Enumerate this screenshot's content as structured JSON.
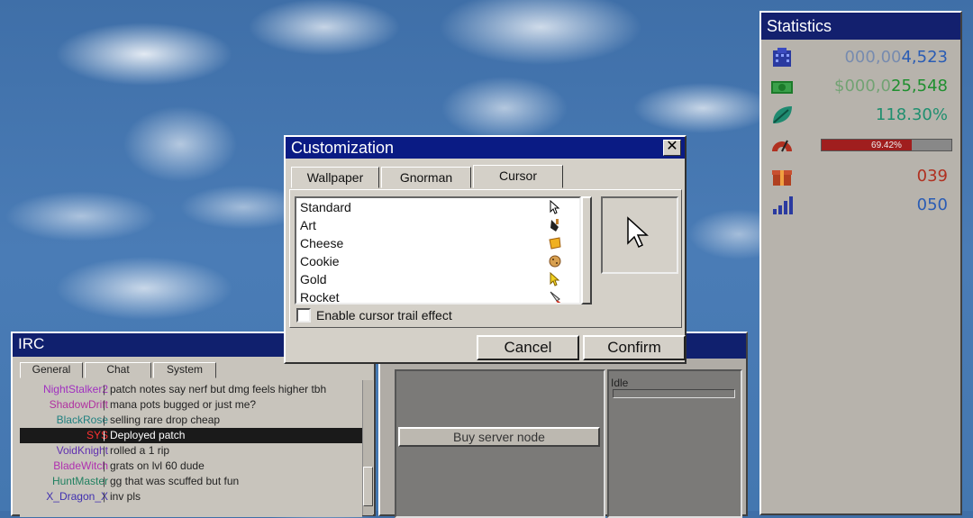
{
  "stats": {
    "title": "Statistics",
    "rows": [
      {
        "icon": "building-icon",
        "dim": "000,00",
        "val": "4,523",
        "color": "#2a5cb4"
      },
      {
        "icon": "money-icon",
        "dim": "$000,0",
        "val": "25,548",
        "color": "#1f8f2f"
      },
      {
        "icon": "leaf-icon",
        "dim": "",
        "val": "118.30%",
        "color": "#1f8f6f"
      },
      {
        "icon": "gauge-icon",
        "bar_text": "69.42%",
        "bar_fraction": 0.6942
      },
      {
        "icon": "gift-icon",
        "dim": "",
        "val": "039",
        "color": "#b03020"
      },
      {
        "icon": "signal-icon",
        "dim": "",
        "val": "050",
        "color": "#2a5cb4"
      }
    ]
  },
  "irc": {
    "title": "IRC",
    "tabs": [
      "General",
      "Chat",
      "System"
    ],
    "lines": [
      {
        "nick": "NightStalker2",
        "msg": "patch notes say nerf but dmg feels higher tbh",
        "color": "#a030c0"
      },
      {
        "nick": "ShadowDrift",
        "msg": "mana pots bugged or just me?",
        "color": "#b030a0"
      },
      {
        "nick": "BlackRose",
        "msg": "selling rare drop cheap",
        "color": "#208080"
      },
      {
        "nick": "SYS",
        "msg": "Deployed patch",
        "color": "#ff3030",
        "sys": true
      },
      {
        "nick": "VoidKnight",
        "msg": "rolled a 1 rip",
        "color": "#6030b0"
      },
      {
        "nick": "BladeWitch",
        "msg": "grats on lvl 60 dude",
        "color": "#b030b0"
      },
      {
        "nick": "HuntMaster",
        "msg": "gg that was scuffed but fun",
        "color": "#208060"
      },
      {
        "nick": "X_Dragon_X",
        "msg": "inv pls",
        "color": "#4030b0"
      }
    ]
  },
  "mid": {
    "buy_label": "Buy server node",
    "idle_label": "Idle"
  },
  "custom": {
    "title": "Customization",
    "close_label": "✕",
    "tabs": [
      "Wallpaper",
      "Gnorman",
      "Cursor"
    ],
    "items": [
      {
        "label": "Standard",
        "icon": "standard-cursor-icon"
      },
      {
        "label": "Art",
        "icon": "art-cursor-icon"
      },
      {
        "label": "Cheese",
        "icon": "cheese-cursor-icon"
      },
      {
        "label": "Cookie",
        "icon": "cookie-cursor-icon"
      },
      {
        "label": "Gold",
        "icon": "gold-cursor-icon"
      },
      {
        "label": "Rocket",
        "icon": "rocket-cursor-icon"
      }
    ],
    "trail_label": "Enable cursor trail effect",
    "cancel_label": "Cancel",
    "confirm_label": "Confirm"
  }
}
